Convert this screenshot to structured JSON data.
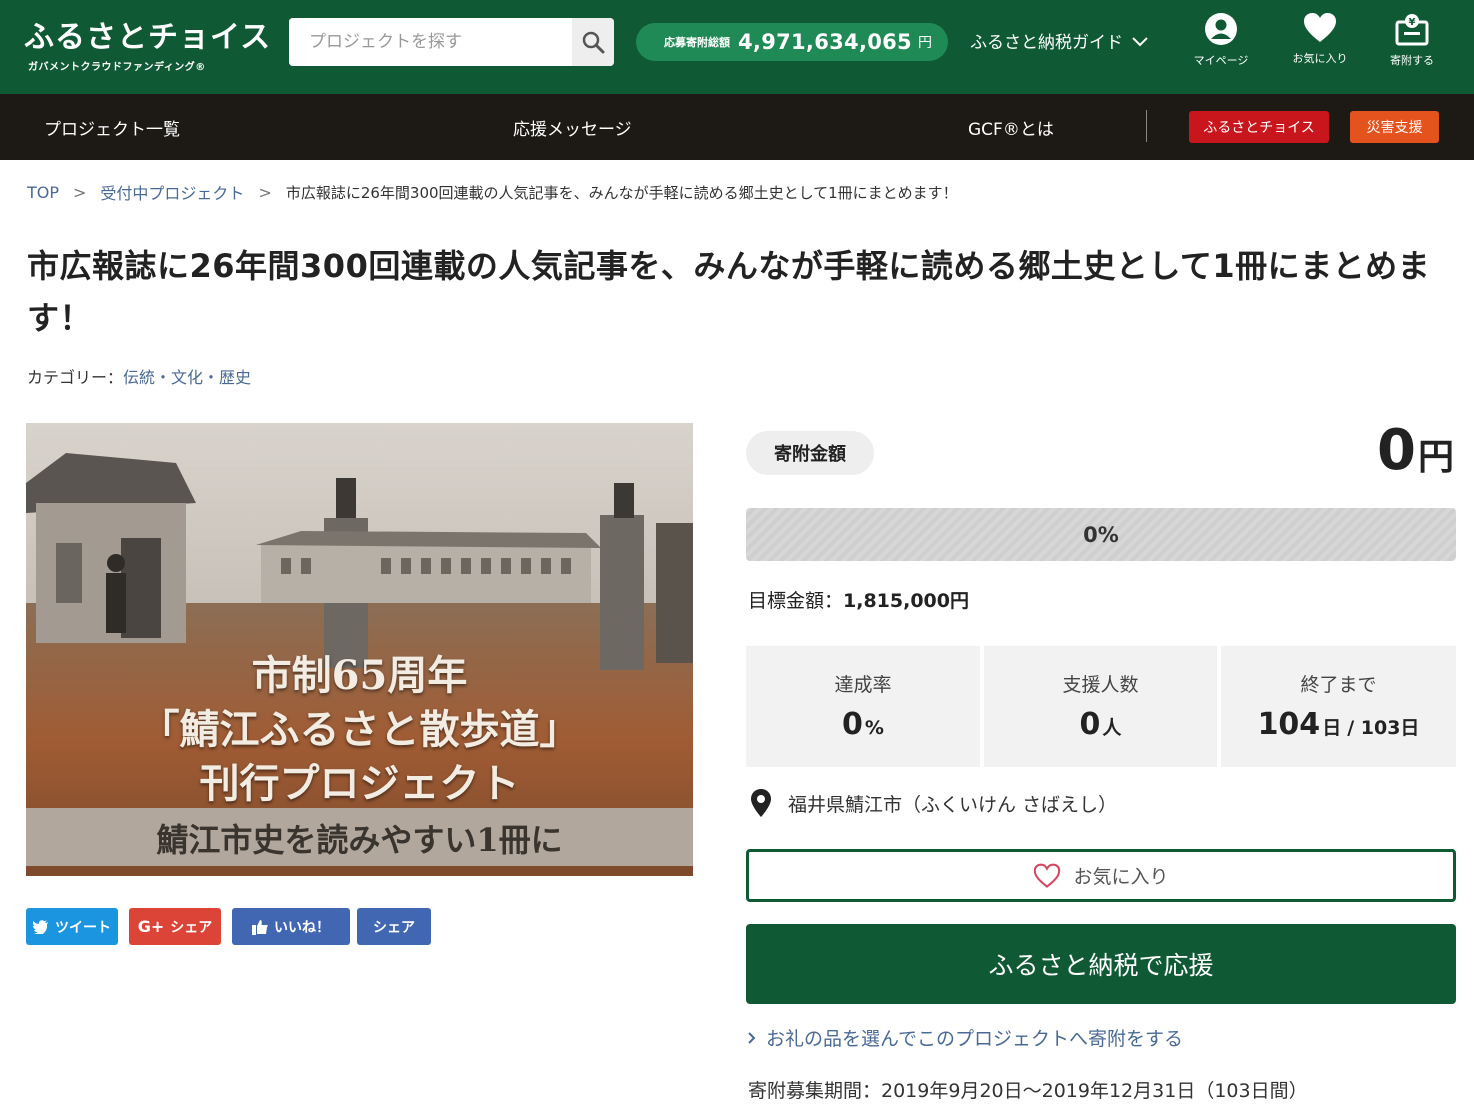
{
  "header": {
    "logo_main": "ふるさとチョイス",
    "logo_sub": "ガバメントクラウドファンディング®",
    "search_placeholder": "プロジェクトを探す",
    "total_label": "応募寄附総額",
    "total_value": "4,971,634,065",
    "total_unit": "円",
    "guide_label": "ふるさと納税ガイド",
    "icons": [
      {
        "label": "マイページ",
        "icon": "user-icon"
      },
      {
        "label": "お気に入り",
        "icon": "heart-icon"
      },
      {
        "label": "寄附する",
        "icon": "donate-box-icon"
      }
    ]
  },
  "nav": {
    "items": [
      "プロジェクト一覧",
      "応援メッセージ",
      "GCF®とは"
    ],
    "furusato_choice": "ふるさとチョイス",
    "disaster_support": "災害支援"
  },
  "breadcrumb": {
    "top": "TOP",
    "sep": ">",
    "projects": "受付中プロジェクト",
    "current": "市広報誌に26年間300回連載の人気記事を、みんなが手軽に読める郷土史として1冊にまとめます！"
  },
  "project": {
    "title": "市広報誌に26年間300回連載の人気記事を、みんなが手軽に読める郷土史として1冊にまとめます！",
    "category_label": "カテゴリー：",
    "category_value": "伝統・文化・歴史",
    "hero_line1": "市制65周年",
    "hero_line2": "「鯖江ふるさと散歩道」",
    "hero_line3": "刊行プロジェクト",
    "hero_line4": "鯖江市史を読みやすい1冊に"
  },
  "social": {
    "tweet": "ツイート",
    "gplus": "シェア",
    "like": "いいね！",
    "share": "シェア"
  },
  "funding": {
    "amount_label": "寄附金額",
    "amount_value": "0",
    "amount_unit": "円",
    "progress": 0,
    "progress_text": "0%",
    "goal_label": "目標金額：",
    "goal_value": "1,815,000円",
    "stats": {
      "rate_label": "達成率",
      "rate_value": "0",
      "rate_unit": "%",
      "supporters_label": "支援人数",
      "supporters_value": "0",
      "supporters_unit": "人",
      "remaining_label": "終了まで",
      "remaining_value": "104",
      "remaining_unit": "日",
      "remaining_total": "/ 103日"
    },
    "location": "福井県鯖江市（ふくいけん さばえし）",
    "favorite_label": "お気に入り",
    "donate_label": "ふるさと納税で応援",
    "gift_link": "お礼の品を選んでこのプロジェクトへ寄附をする",
    "period": "寄附募集期間：2019年9月20日〜2019年12月31日（103日間）"
  },
  "colors": {
    "brand_green": "#0f5a34",
    "pill_green": "#1f8a55",
    "nav_dark": "#1d1a15",
    "choice_red": "#c9161d",
    "disaster_orange": "#e4531e",
    "link_blue": "#4a6a96",
    "twitter": "#1b95e0",
    "gplus": "#db4437",
    "facebook": "#4267b2"
  }
}
